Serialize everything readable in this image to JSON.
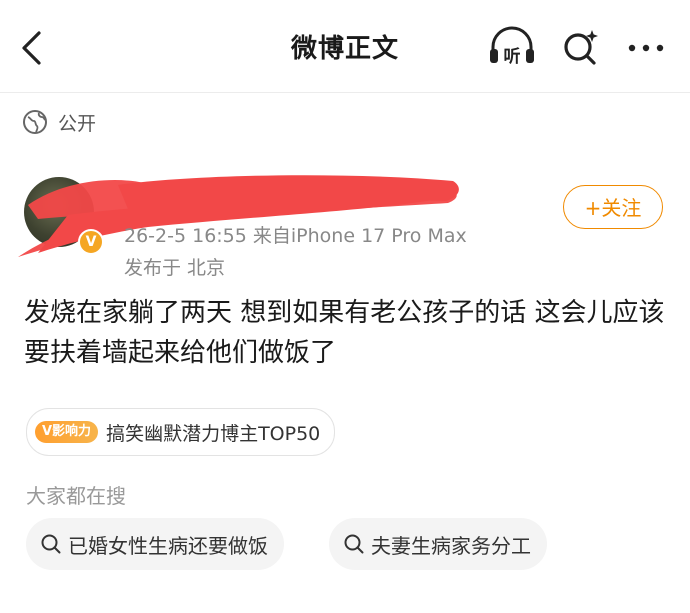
{
  "header": {
    "title": "微博正文",
    "back_icon": "chevron-left-icon",
    "listen_label": "听",
    "ai_search_icon": "sparkle-search-icon",
    "more_icon": "more-dots-icon"
  },
  "visibility": {
    "icon": "globe-icon",
    "label": "公开"
  },
  "post": {
    "meta": "26-2-5 16:55  来自iPhone 17 Pro Max",
    "location": "发布于 北京",
    "follow_label": "+关注",
    "verified_badge": "V",
    "content": "发烧在家躺了两天 想到如果有老公孩子的话 这会儿应该要扶着墙起来给他们做饭了",
    "influence": {
      "badge": "V影响力",
      "text": "搞笑幽默潜力博主TOP50"
    }
  },
  "trending": {
    "label": "大家都在搜",
    "items": [
      {
        "text": "已婚女性生病还要做饭"
      },
      {
        "text": "夫妻生病家务分工"
      }
    ]
  },
  "colors": {
    "accent": "#f08a00",
    "redaction": "#f24848",
    "verified": "#f5a623"
  }
}
